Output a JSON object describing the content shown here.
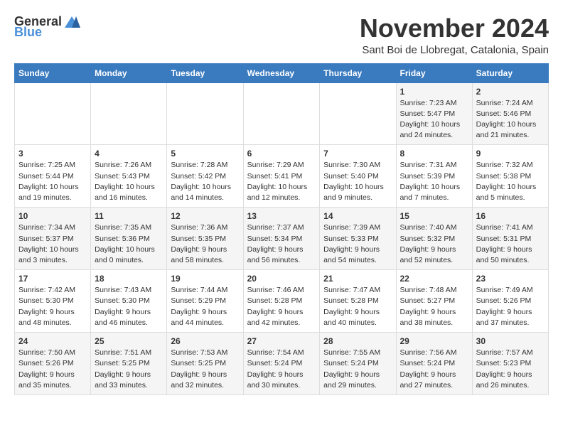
{
  "logo": {
    "text_general": "General",
    "text_blue": "Blue"
  },
  "title": "November 2024",
  "subtitle": "Sant Boi de Llobregat, Catalonia, Spain",
  "weekdays": [
    "Sunday",
    "Monday",
    "Tuesday",
    "Wednesday",
    "Thursday",
    "Friday",
    "Saturday"
  ],
  "weeks": [
    [
      {
        "day": "",
        "content": ""
      },
      {
        "day": "",
        "content": ""
      },
      {
        "day": "",
        "content": ""
      },
      {
        "day": "",
        "content": ""
      },
      {
        "day": "",
        "content": ""
      },
      {
        "day": "1",
        "content": "Sunrise: 7:23 AM\nSunset: 5:47 PM\nDaylight: 10 hours and 24 minutes."
      },
      {
        "day": "2",
        "content": "Sunrise: 7:24 AM\nSunset: 5:46 PM\nDaylight: 10 hours and 21 minutes."
      }
    ],
    [
      {
        "day": "3",
        "content": "Sunrise: 7:25 AM\nSunset: 5:44 PM\nDaylight: 10 hours and 19 minutes."
      },
      {
        "day": "4",
        "content": "Sunrise: 7:26 AM\nSunset: 5:43 PM\nDaylight: 10 hours and 16 minutes."
      },
      {
        "day": "5",
        "content": "Sunrise: 7:28 AM\nSunset: 5:42 PM\nDaylight: 10 hours and 14 minutes."
      },
      {
        "day": "6",
        "content": "Sunrise: 7:29 AM\nSunset: 5:41 PM\nDaylight: 10 hours and 12 minutes."
      },
      {
        "day": "7",
        "content": "Sunrise: 7:30 AM\nSunset: 5:40 PM\nDaylight: 10 hours and 9 minutes."
      },
      {
        "day": "8",
        "content": "Sunrise: 7:31 AM\nSunset: 5:39 PM\nDaylight: 10 hours and 7 minutes."
      },
      {
        "day": "9",
        "content": "Sunrise: 7:32 AM\nSunset: 5:38 PM\nDaylight: 10 hours and 5 minutes."
      }
    ],
    [
      {
        "day": "10",
        "content": "Sunrise: 7:34 AM\nSunset: 5:37 PM\nDaylight: 10 hours and 3 minutes."
      },
      {
        "day": "11",
        "content": "Sunrise: 7:35 AM\nSunset: 5:36 PM\nDaylight: 10 hours and 0 minutes."
      },
      {
        "day": "12",
        "content": "Sunrise: 7:36 AM\nSunset: 5:35 PM\nDaylight: 9 hours and 58 minutes."
      },
      {
        "day": "13",
        "content": "Sunrise: 7:37 AM\nSunset: 5:34 PM\nDaylight: 9 hours and 56 minutes."
      },
      {
        "day": "14",
        "content": "Sunrise: 7:39 AM\nSunset: 5:33 PM\nDaylight: 9 hours and 54 minutes."
      },
      {
        "day": "15",
        "content": "Sunrise: 7:40 AM\nSunset: 5:32 PM\nDaylight: 9 hours and 52 minutes."
      },
      {
        "day": "16",
        "content": "Sunrise: 7:41 AM\nSunset: 5:31 PM\nDaylight: 9 hours and 50 minutes."
      }
    ],
    [
      {
        "day": "17",
        "content": "Sunrise: 7:42 AM\nSunset: 5:30 PM\nDaylight: 9 hours and 48 minutes."
      },
      {
        "day": "18",
        "content": "Sunrise: 7:43 AM\nSunset: 5:30 PM\nDaylight: 9 hours and 46 minutes."
      },
      {
        "day": "19",
        "content": "Sunrise: 7:44 AM\nSunset: 5:29 PM\nDaylight: 9 hours and 44 minutes."
      },
      {
        "day": "20",
        "content": "Sunrise: 7:46 AM\nSunset: 5:28 PM\nDaylight: 9 hours and 42 minutes."
      },
      {
        "day": "21",
        "content": "Sunrise: 7:47 AM\nSunset: 5:28 PM\nDaylight: 9 hours and 40 minutes."
      },
      {
        "day": "22",
        "content": "Sunrise: 7:48 AM\nSunset: 5:27 PM\nDaylight: 9 hours and 38 minutes."
      },
      {
        "day": "23",
        "content": "Sunrise: 7:49 AM\nSunset: 5:26 PM\nDaylight: 9 hours and 37 minutes."
      }
    ],
    [
      {
        "day": "24",
        "content": "Sunrise: 7:50 AM\nSunset: 5:26 PM\nDaylight: 9 hours and 35 minutes."
      },
      {
        "day": "25",
        "content": "Sunrise: 7:51 AM\nSunset: 5:25 PM\nDaylight: 9 hours and 33 minutes."
      },
      {
        "day": "26",
        "content": "Sunrise: 7:53 AM\nSunset: 5:25 PM\nDaylight: 9 hours and 32 minutes."
      },
      {
        "day": "27",
        "content": "Sunrise: 7:54 AM\nSunset: 5:24 PM\nDaylight: 9 hours and 30 minutes."
      },
      {
        "day": "28",
        "content": "Sunrise: 7:55 AM\nSunset: 5:24 PM\nDaylight: 9 hours and 29 minutes."
      },
      {
        "day": "29",
        "content": "Sunrise: 7:56 AM\nSunset: 5:24 PM\nDaylight: 9 hours and 27 minutes."
      },
      {
        "day": "30",
        "content": "Sunrise: 7:57 AM\nSunset: 5:23 PM\nDaylight: 9 hours and 26 minutes."
      }
    ]
  ]
}
